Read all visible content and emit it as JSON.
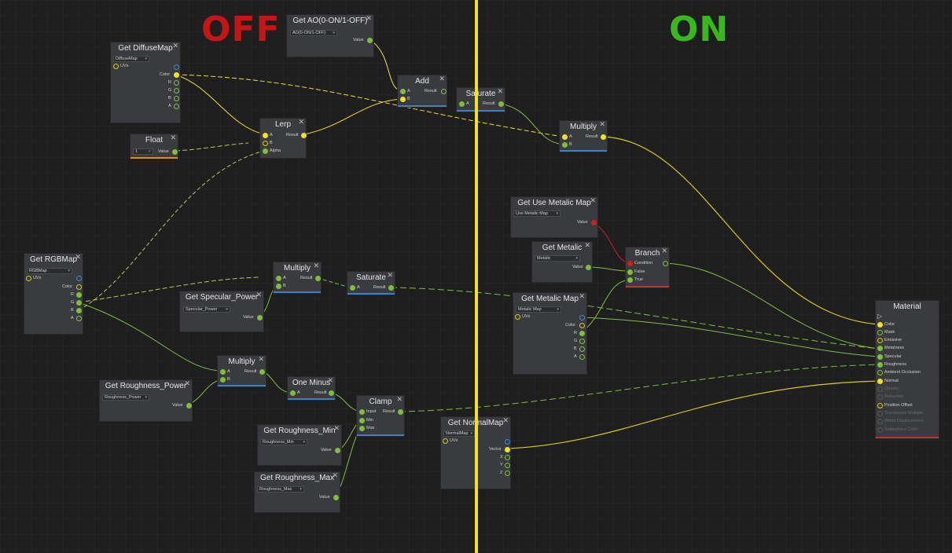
{
  "labels": {
    "off": "OFF",
    "on": "ON"
  },
  "nodes": {
    "get_ao": {
      "title": "Get AO(0-ON/1-OFF)",
      "dropdown": "AO(0-ON/1-OFF)",
      "out": "Value"
    },
    "get_diffuse": {
      "title": "Get DiffuseMap",
      "dropdown": "DiffuseMap",
      "in_uvs": "UVs",
      "outs": [
        "Color",
        "R",
        "G",
        "B",
        "A"
      ]
    },
    "float": {
      "title": "Float",
      "value": "1",
      "out": "Value"
    },
    "lerp": {
      "title": "Lerp",
      "ins": [
        "A",
        "B",
        "Alpha"
      ],
      "out": "Result"
    },
    "add": {
      "title": "Add",
      "ins": [
        "A",
        "B"
      ],
      "out": "Result"
    },
    "saturate_top": {
      "title": "Saturate",
      "ins": [
        "A"
      ],
      "out": "Result"
    },
    "multiply_top": {
      "title": "Multiply",
      "ins": [
        "A",
        "B"
      ],
      "out": "Result"
    },
    "get_rgb": {
      "title": "Get RGBMap",
      "dropdown": "RGBMap",
      "in_uvs": "UVs",
      "outs": [
        "Color",
        "R",
        "G",
        "B",
        "A"
      ]
    },
    "get_spec": {
      "title": "Get Specular_Power",
      "dropdown": "Specular_Power",
      "out": "Value"
    },
    "multiply_mid": {
      "title": "Multiply",
      "ins": [
        "A",
        "B"
      ],
      "out": "Result"
    },
    "saturate_mid": {
      "title": "Saturate",
      "ins": [
        "A"
      ],
      "out": "Result"
    },
    "multiply_low": {
      "title": "Multiply",
      "ins": [
        "A",
        "B"
      ],
      "out": "Result"
    },
    "get_rough_pow": {
      "title": "Get Roughness_Power",
      "dropdown": "Roughness_Power",
      "out": "Value"
    },
    "one_minus": {
      "title": "One Minus",
      "ins": [
        "A"
      ],
      "out": "Result"
    },
    "clamp": {
      "title": "Clamp",
      "ins": [
        "Input",
        "Min",
        "Max"
      ],
      "out": "Result"
    },
    "get_rough_min": {
      "title": "Get Roughness_Min",
      "dropdown": "Roughness_Min",
      "out": "Value"
    },
    "get_rough_max": {
      "title": "Get Roughness_Max",
      "dropdown": "Roughness_Max",
      "out": "Value"
    },
    "get_normal": {
      "title": "Get NormalMap",
      "dropdown": "NormalMap",
      "in_uvs": "UVs",
      "outs": [
        "Vector",
        "X",
        "Y",
        "Z"
      ]
    },
    "get_use_metalic": {
      "title": "Get Use Metalic Map",
      "dropdown": "Use Metalic Map",
      "out": "Value"
    },
    "get_metalic": {
      "title": "Get Metalic",
      "dropdown": "Metalic",
      "out": "Value"
    },
    "branch": {
      "title": "Branch",
      "ins": [
        "Condition",
        "False",
        "True"
      ]
    },
    "get_metalic_map": {
      "title": "Get Metalic Map",
      "dropdown": "Metalic Map",
      "in_uvs": "UVs",
      "outs": [
        "Color",
        "R",
        "G",
        "B",
        "A"
      ]
    },
    "material": {
      "title": "Material",
      "ins": [
        "Color",
        "Mask",
        "Emissive",
        "Metalness",
        "Specular",
        "Roughness",
        "Ambient Occlusion",
        "Normal",
        "Opacity",
        "Refraction",
        "Position Offset",
        "Translucent Multiple",
        "World Displacement",
        "Subsurface Color"
      ]
    }
  },
  "colors": {
    "wire_yellow": "#f2e21b",
    "wire_green": "#7fbf3b",
    "wire_red": "#d02020",
    "off_label": "#c41616",
    "on_label": "#38b81c",
    "divider": "#f2e21b"
  }
}
